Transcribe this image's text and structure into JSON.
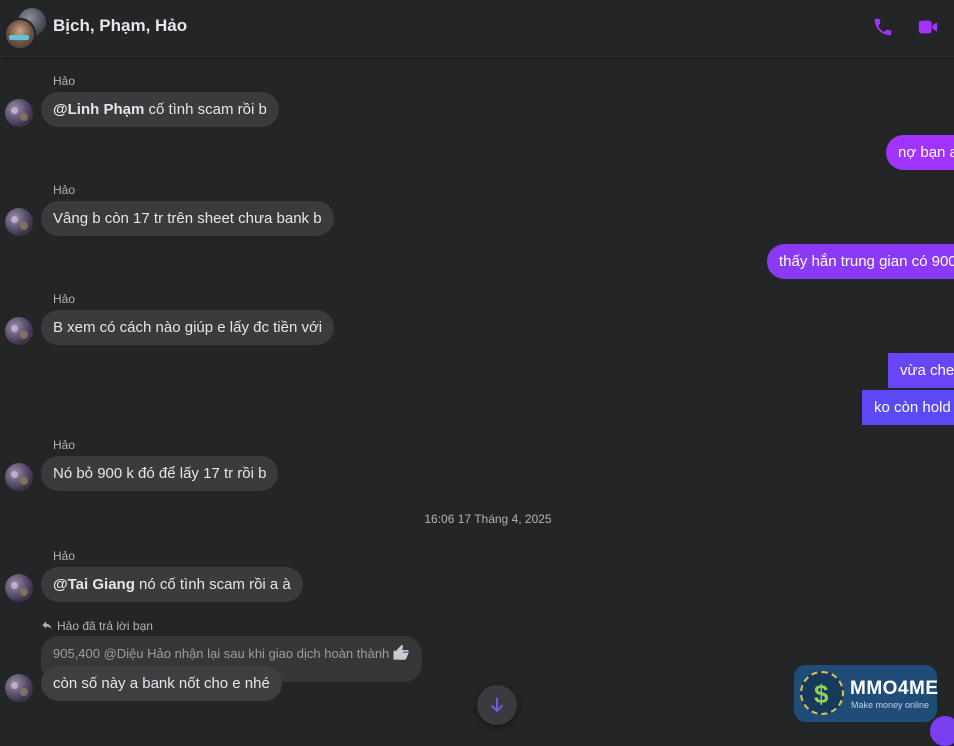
{
  "header": {
    "title": "Bịch, Phạm, Hảo",
    "accent": "#a033ff"
  },
  "messages": [
    {
      "sender": "Hảo",
      "mention": "@Linh Phạm",
      "text": " cố tình scam rồi b"
    },
    {
      "out": "nợ bạn a"
    },
    {
      "sender": "Hảo",
      "text": "Vâng b còn 17 tr trên sheet chưa bank b"
    },
    {
      "out": "thấy hắn trung gian có 900"
    },
    {
      "sender": "Hảo",
      "text": "B xem có cách nào giúp e lấy đc tiền với"
    },
    {
      "out": "vừa chec"
    },
    {
      "out": "ko còn hold"
    },
    {
      "sender": "Hảo",
      "text": "Nó bỏ 900 k đó để lấy 17 tr rồi b"
    },
    {
      "sender": "Hảo",
      "mention": "@Tai Giang",
      "text": " nó cố tình scam rồi a à"
    }
  ],
  "timestamp": "16:06 17 Tháng 4, 2025",
  "reply": {
    "note": "Hảo đã trả lời bạn",
    "quoted": "905,400 @Diệu Hảo nhận lại sau khi giao dịch hoàn thành",
    "text": "còn số này a bank nốt cho e nhé"
  },
  "watermark": {
    "symbol": "$",
    "name": "MMO4ME",
    "tagline": "Make money online"
  },
  "colors": {
    "background": "#242526",
    "incoming_bubble": "#3a3b3c",
    "outgoing_gradient": [
      "#a033ff",
      "#7b3ff2",
      "#5b49f5"
    ]
  }
}
